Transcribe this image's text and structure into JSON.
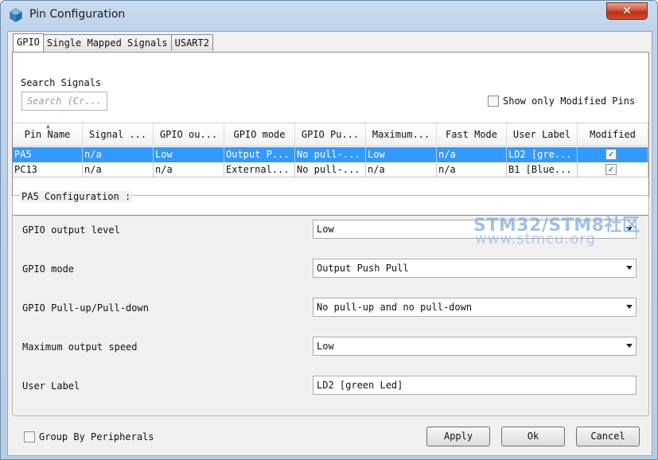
{
  "window": {
    "title": "Pin Configuration",
    "close_glyph": "✕"
  },
  "tabs": [
    {
      "label": "GPIO",
      "active": true
    },
    {
      "label": "Single Mapped Signals",
      "active": false
    },
    {
      "label": "USART2",
      "active": false
    }
  ],
  "search": {
    "label": "Search Signals",
    "placeholder": "Search (Cr..."
  },
  "show_only_modified": {
    "label": "Show only Modified Pins",
    "checked": false
  },
  "table": {
    "headers": [
      "Pin Name",
      "Signal ...",
      "GPIO ou...",
      "GPIO mode",
      "GPIO Pu...",
      "Maximum...",
      "Fast Mode",
      "User Label",
      "Modified"
    ],
    "rows": [
      {
        "cells": [
          "PA5",
          "n/a",
          "Low",
          "Output P...",
          "No pull-...",
          "Low",
          "n/a",
          "LD2 [gre..."
        ],
        "modified": true,
        "selected": true
      },
      {
        "cells": [
          "PC13",
          "n/a",
          "n/a",
          "External...",
          "No pull-...",
          "n/a",
          "n/a",
          "B1 [Blue..."
        ],
        "modified": true,
        "selected": false
      }
    ]
  },
  "config": {
    "title": "PA5 Configuration :",
    "fields": [
      {
        "label": "GPIO output level",
        "value": "Low"
      },
      {
        "label": "GPIO mode",
        "value": "Output Push Pull"
      },
      {
        "label": "GPIO Pull-up/Pull-down",
        "value": "No pull-up and no pull-down"
      },
      {
        "label": "Maximum output speed",
        "value": "Low"
      },
      {
        "label": "User Label",
        "value": "LD2 [green Led]"
      }
    ]
  },
  "watermark": {
    "line1": "STM32/STM8社区",
    "line2": "www.stmcu.org"
  },
  "footer": {
    "group_by_peripherals": {
      "label": "Group By Peripherals",
      "checked": false
    },
    "apply_label": "Apply",
    "ok_label": "Ok",
    "cancel_label": "Cancel"
  },
  "colors": {
    "selection": "#3399ff",
    "title_bar": "#c9dcef",
    "close_button": "#c94b2e"
  }
}
